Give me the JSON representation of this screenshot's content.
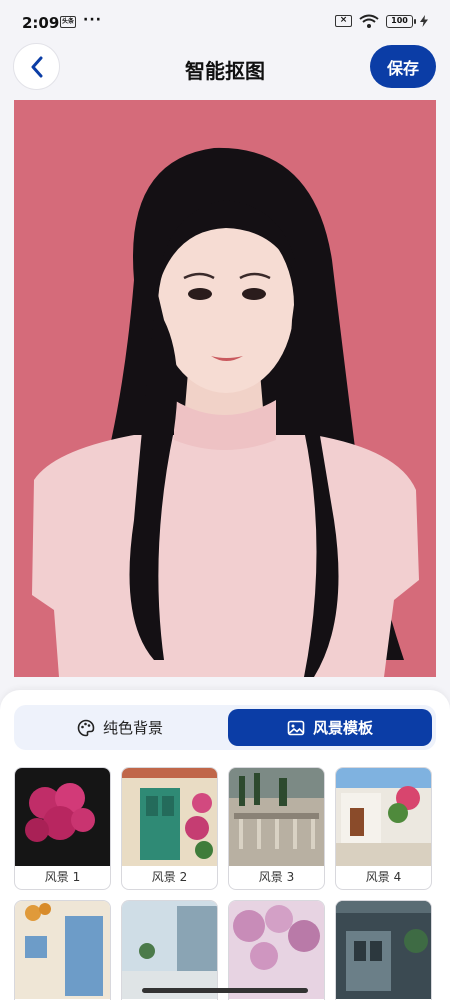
{
  "status_bar": {
    "time": "2:09",
    "news_badge": "头条",
    "dots": "···",
    "sim_icon": "sim-x-icon",
    "battery_level": "100"
  },
  "header": {
    "back_icon": "chevron-left-icon",
    "title": "智能抠图",
    "save_label": "保存"
  },
  "tabs": [
    {
      "label": "纯色背景",
      "icon": "palette-icon",
      "active": false
    },
    {
      "label": "风景模板",
      "icon": "image-icon",
      "active": true
    }
  ],
  "templates": [
    {
      "label": "风景 1"
    },
    {
      "label": "风景 2"
    },
    {
      "label": "风景 3"
    },
    {
      "label": "风景 4"
    },
    {
      "label": ""
    },
    {
      "label": ""
    },
    {
      "label": ""
    },
    {
      "label": ""
    }
  ],
  "colors": {
    "accent": "#0b3da6",
    "photo_background": "#d56b7a",
    "tab_bar_background": "#eef2fb"
  }
}
